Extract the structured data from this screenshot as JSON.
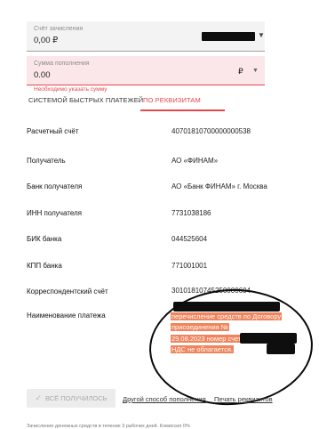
{
  "account": {
    "label": "Счёт зачисления",
    "value": "0,00 ₽",
    "chevron_icon": "chevron-down-icon"
  },
  "amount": {
    "label": "Сумма пополнения",
    "value": "0.00",
    "currency": "₽",
    "error": "Необходимо указать сумму",
    "error_color": "#e5474d"
  },
  "tabs": [
    {
      "label": "СИСТЕМОЙ БЫСТРЫХ ПЛАТЕЖЕЙ",
      "active": false
    },
    {
      "label": "ПО РЕКВИЗИТАМ",
      "active": true
    }
  ],
  "details": [
    {
      "label": "Расчетный счёт",
      "value": "40701810700000000538"
    },
    {
      "label": "Получатель",
      "value": "АО «ФИНАМ»"
    },
    {
      "label": "Банк получателя",
      "value": "АО «Банк ФИНАМ» г. Москва"
    },
    {
      "label": "ИНН получателя",
      "value": "7731038186"
    },
    {
      "label": "БИК банка",
      "value": "044525604"
    },
    {
      "label": "КПП банка",
      "value": "771001001"
    },
    {
      "label": "Корреспондентский счёт",
      "value": "30101810745250000604"
    }
  ],
  "purpose": {
    "label": "Наименование платежа",
    "lines": [
      "перечисление средств по Договору",
      "присоединения №",
      "29.08.2023 номер счета КлФ",
      "НДС не облагается."
    ],
    "highlight_color": "#f0845c"
  },
  "actions": {
    "received_label": "ВСЁ ПОЛУЧИЛОСЬ",
    "other_method_label": "Другой способ пополнения",
    "print_label": "Печать реквизитов"
  },
  "footnote": "Зачисление денежных средств в течение 3 рабочих дней. Комиссия 0%"
}
